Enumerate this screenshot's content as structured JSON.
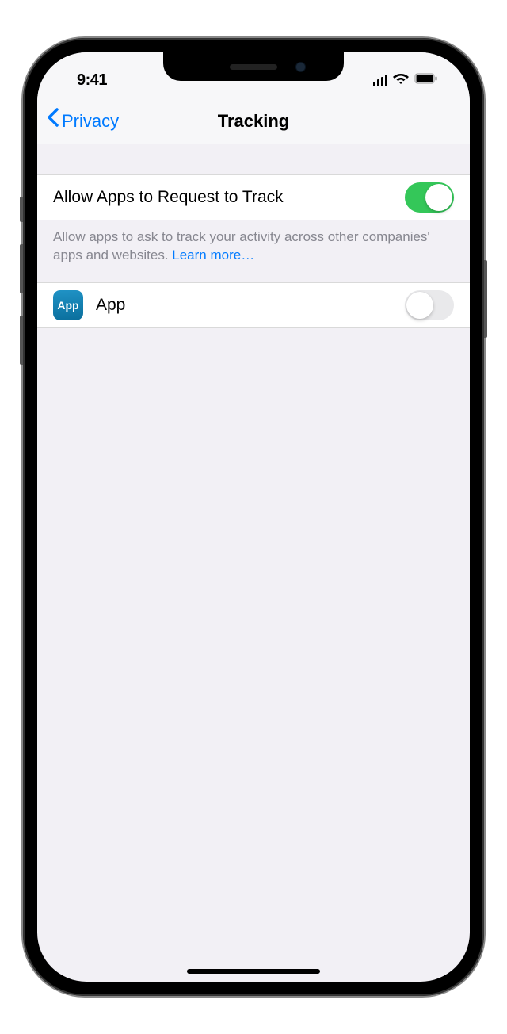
{
  "statusBar": {
    "time": "9:41"
  },
  "navBar": {
    "backLabel": "Privacy",
    "title": "Tracking"
  },
  "mainToggle": {
    "label": "Allow Apps to Request to Track",
    "on": true
  },
  "footer": {
    "text": "Allow apps to ask to track your activity across other companies' apps and websites. ",
    "linkText": "Learn more…"
  },
  "appRow": {
    "iconLabel": "App",
    "name": "App",
    "on": false
  }
}
